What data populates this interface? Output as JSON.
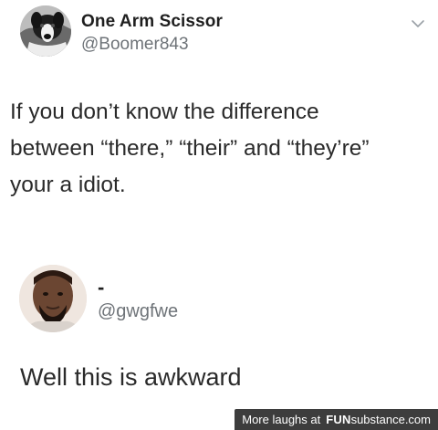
{
  "tweet_top": {
    "display_name": "One Arm Scissor",
    "handle": "@Boomer843",
    "body_lines": [
      "If you don’t know the difference",
      "between “there,” “their” and “they’re”",
      "your a idiot."
    ],
    "menu_icon": "chevron-down-icon",
    "avatar_icon": "dog-avatar"
  },
  "tweet_reply": {
    "display_name": "-",
    "handle": "@gwgfwe",
    "body": "Well this is awkward",
    "avatar_icon": "man-avatar"
  },
  "footer": {
    "lead": "More laughs at",
    "brand_bold": "FUN",
    "brand_rest": "substance.com"
  },
  "colors": {
    "text": "#2a2a2a",
    "handle": "#6e7378",
    "footer_bg": "#3d3d3d"
  }
}
